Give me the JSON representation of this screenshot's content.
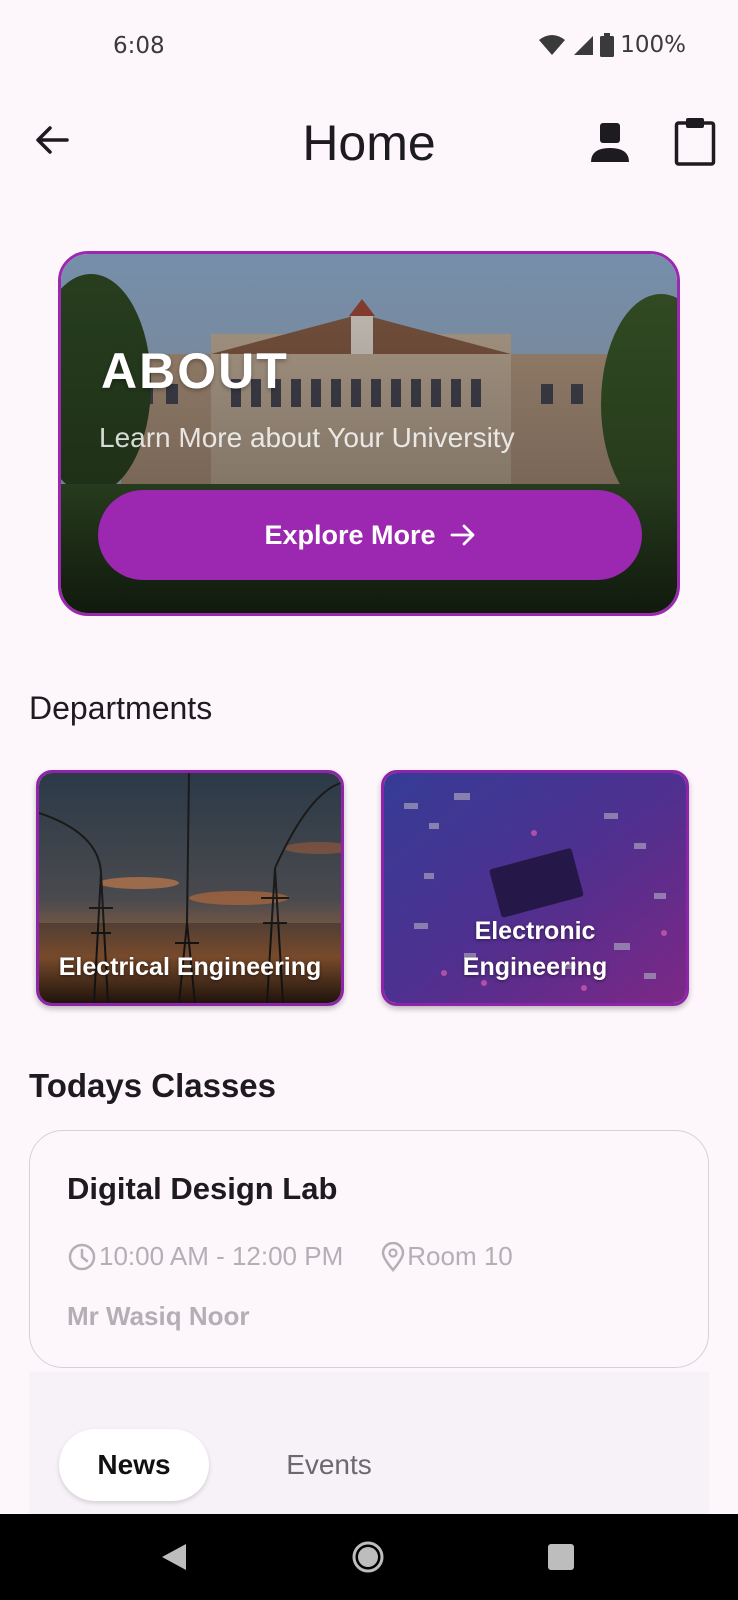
{
  "status_bar": {
    "time": "6:08",
    "battery": "100%"
  },
  "app_bar": {
    "title": "Home"
  },
  "about": {
    "heading": "ABOUT",
    "subtitle": "Learn More about Your University",
    "button_label": "Explore More"
  },
  "departments": {
    "title": "Departments",
    "items": [
      {
        "label": "Electrical Engineering"
      },
      {
        "label": "Electronic Engineering"
      }
    ]
  },
  "classes": {
    "title": "Todays Classes",
    "items": [
      {
        "name": "Digital Design Lab",
        "time": "10:00 AM - 12:00 PM",
        "room": "Room 10",
        "teacher": "Mr Wasiq Noor"
      }
    ]
  },
  "tabs": [
    {
      "label": "News",
      "selected": true
    },
    {
      "label": "Events",
      "selected": false
    }
  ],
  "colors": {
    "accent": "#9c27b0",
    "background": "#fdf7fc"
  },
  "icons": [
    "back-arrow-icon",
    "person-icon",
    "clipboard-icon",
    "arrow-right-icon",
    "clock-icon",
    "location-pin-icon",
    "wifi-icon",
    "signal-icon",
    "battery-icon"
  ]
}
